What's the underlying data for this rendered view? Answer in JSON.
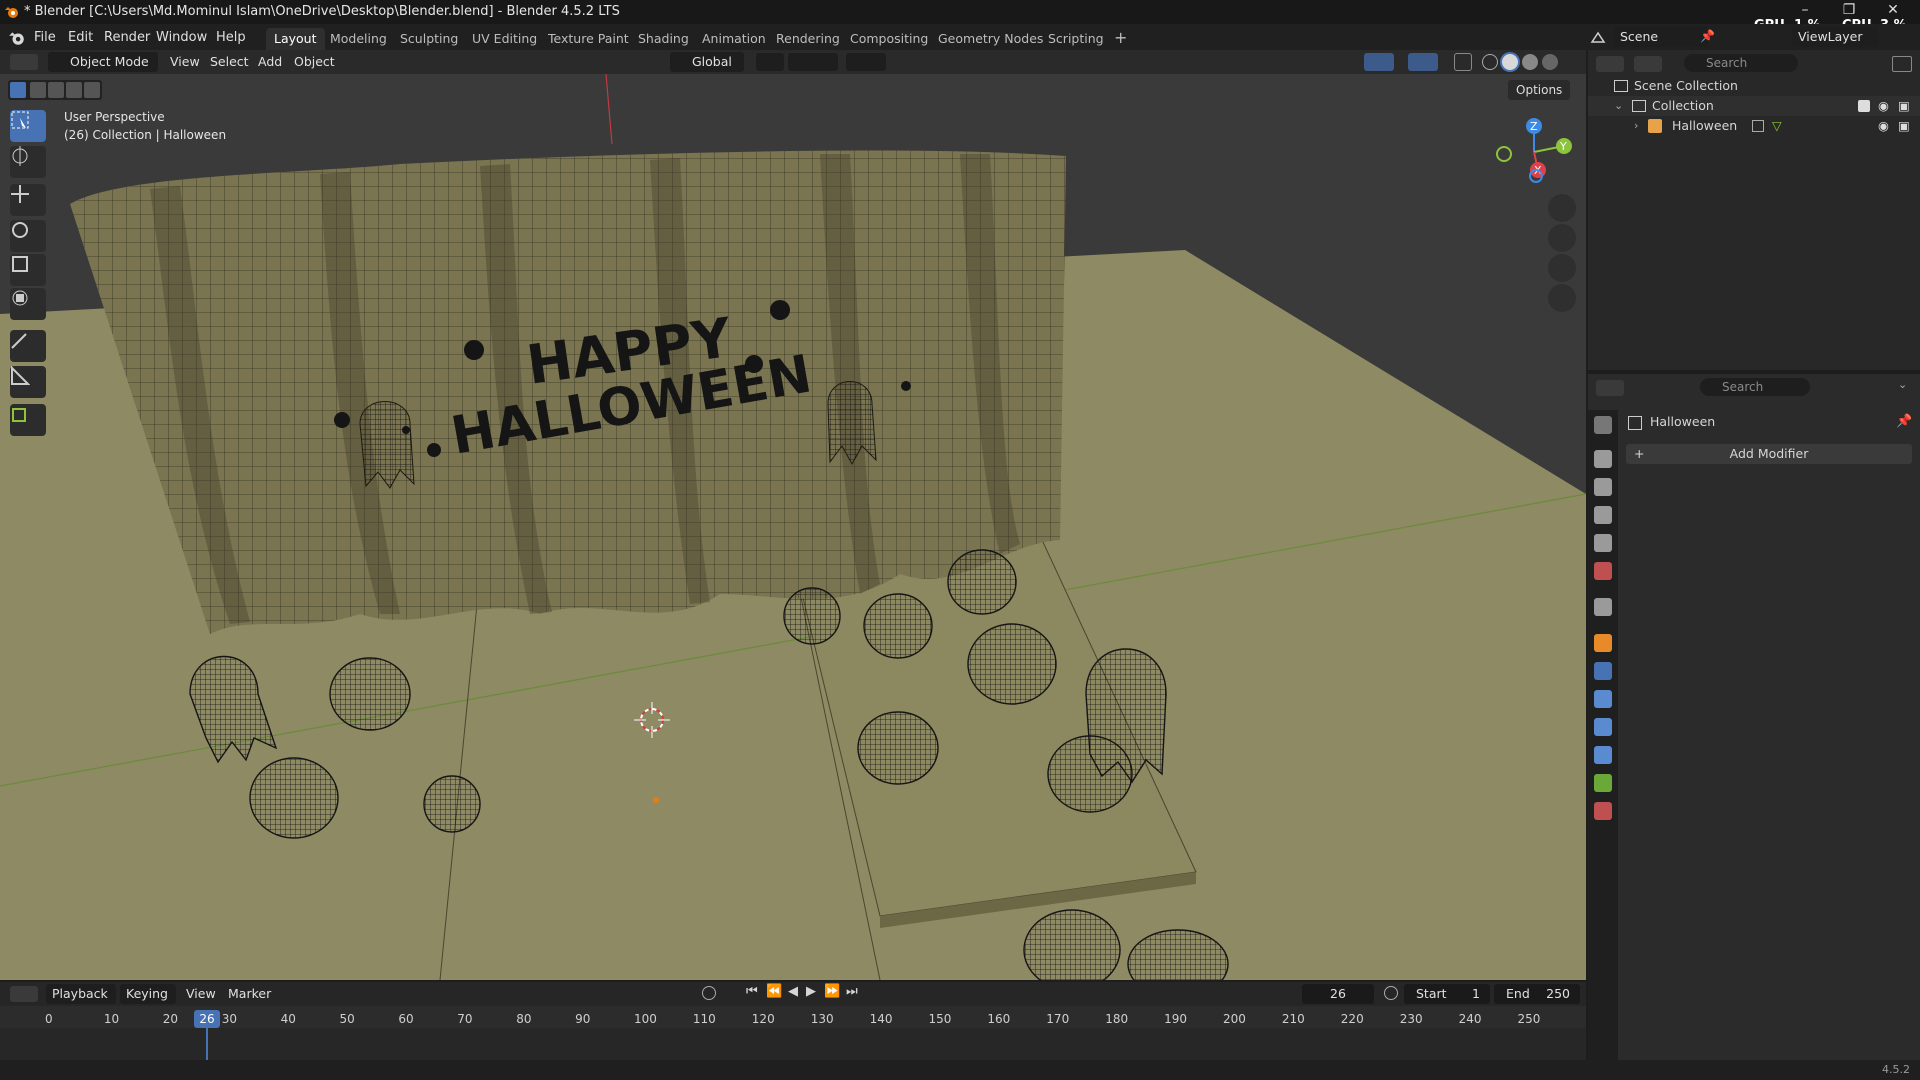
{
  "window": {
    "title": "* Blender [C:\\Users\\Md.Mominul Islam\\OneDrive\\Desktop\\Blender.blend] - Blender 4.5.2 LTS",
    "gpu_label": "GPU",
    "gpu_value": "1 %",
    "cpu_label": "CPU",
    "cpu_value": "3 %"
  },
  "menu": [
    "File",
    "Edit",
    "Render",
    "Window",
    "Help"
  ],
  "workspaces": [
    "Layout",
    "Modeling",
    "Sculpting",
    "UV Editing",
    "Texture Paint",
    "Shading",
    "Animation",
    "Rendering",
    "Compositing",
    "Geometry Nodes",
    "Scripting"
  ],
  "active_workspace": "Layout",
  "scene": {
    "scene_name": "Scene",
    "view_layer": "ViewLayer"
  },
  "viewport_header": {
    "mode": "Object Mode",
    "menus": [
      "View",
      "Select",
      "Add",
      "Object"
    ],
    "transform_orientation": "Global",
    "options_label": "Options"
  },
  "viewport": {
    "perspective_label": "User Perspective",
    "collection_label": "(26) Collection | Halloween",
    "wall_text_line1": "HAPPY",
    "wall_text_line2": "HALLOWEEN",
    "axis_x": "X",
    "axis_y": "Y",
    "axis_z": "Z"
  },
  "outliner": {
    "search_placeholder": "Search",
    "scene_collection": "Scene Collection",
    "collection": "Collection",
    "object": "Halloween"
  },
  "properties": {
    "search_placeholder": "Search",
    "object_name": "Halloween",
    "add_modifier": "Add Modifier"
  },
  "timeline": {
    "menus": [
      "Playback",
      "Keying",
      "View",
      "Marker"
    ],
    "current_frame": "26",
    "start_label": "Start",
    "start_value": "1",
    "end_label": "End",
    "end_value": "250",
    "ruler": [
      "0",
      "10",
      "20",
      "30",
      "40",
      "50",
      "60",
      "70",
      "80",
      "90",
      "100",
      "110",
      "120",
      "130",
      "140",
      "150",
      "160",
      "170",
      "180",
      "190",
      "200",
      "210",
      "220",
      "230",
      "240",
      "250"
    ],
    "playhead_label": "26"
  },
  "status": {
    "version": "4.5.2"
  },
  "colors": {
    "accent": "#4772b3",
    "floor": "#8e8a63",
    "wall": "#7a7450",
    "x_axis": "#e0404a",
    "y_axis": "#8cc43c",
    "z_axis": "#3d8be6"
  }
}
